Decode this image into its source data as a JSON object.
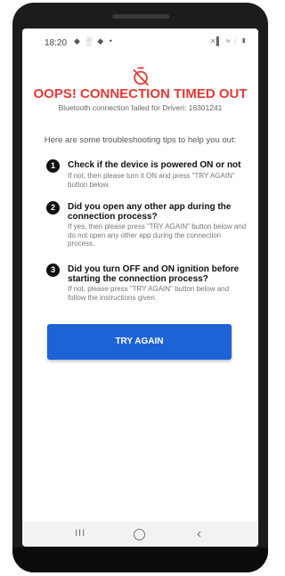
{
  "status_bar": {
    "time": "18:20",
    "notification_icons": "◆ ░ ◆ •",
    "system_icons": "×▌ ≈ ⫶ ▮"
  },
  "screen": {
    "icon": "timer-off-icon",
    "title": "OOPS! CONNECTION TIMED OUT",
    "subtitle": "Bluetooth connection failed for Driveri: 16301241",
    "intro": "Here are some troubleshooting tips to help you out:",
    "tips": [
      {
        "number": "1",
        "title": "Check if the device is powered ON or not",
        "body": "If not, then please turn it ON and press \"TRY AGAIN\" button below."
      },
      {
        "number": "2",
        "title": "Did you open any other app during the connection process?",
        "body": "If yes, then please press \"TRY AGAIN\" button below and do not open any other app during the connection process."
      },
      {
        "number": "3",
        "title": "Did you turn OFF and ON ignition before starting the connection process?",
        "body": "If not, please press \"TRY AGAIN\" button below and follow the instructions given."
      }
    ],
    "button_label": "TRY AGAIN"
  },
  "nav_bar": {
    "recents": "III",
    "back": "‹"
  },
  "colors": {
    "accent_red": "#e53935",
    "button_blue": "#1e63d6",
    "phone_body": "#1c1c1c"
  }
}
